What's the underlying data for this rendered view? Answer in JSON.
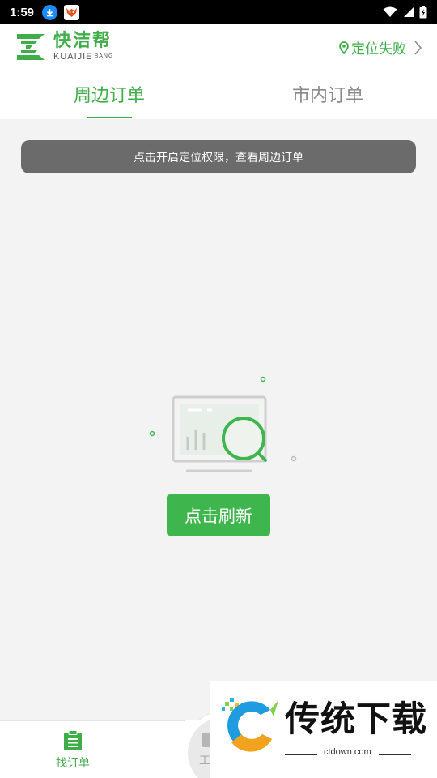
{
  "status_bar": {
    "time": "1:59"
  },
  "header": {
    "logo_cn": "快洁帮",
    "logo_en": "KUAIJIE",
    "logo_en_small": "BANG",
    "location_text": "定位失败"
  },
  "tabs": [
    {
      "label": "周边订单",
      "active": true
    },
    {
      "label": "市内订单",
      "active": false
    }
  ],
  "notice": {
    "text": "点击开启定位权限，查看周边订单"
  },
  "empty_state": {
    "button_label": "点击刷新"
  },
  "bottom_nav": {
    "items": [
      {
        "label": "找订单",
        "active": true
      },
      {
        "label": "工"
      }
    ]
  },
  "watermark": {
    "title": "传统下载",
    "domain": "ctdown.com"
  },
  "colors": {
    "brand_green": "#3fae49",
    "notice_bg": "#6b6b6b",
    "background": "#f3f3f3"
  }
}
